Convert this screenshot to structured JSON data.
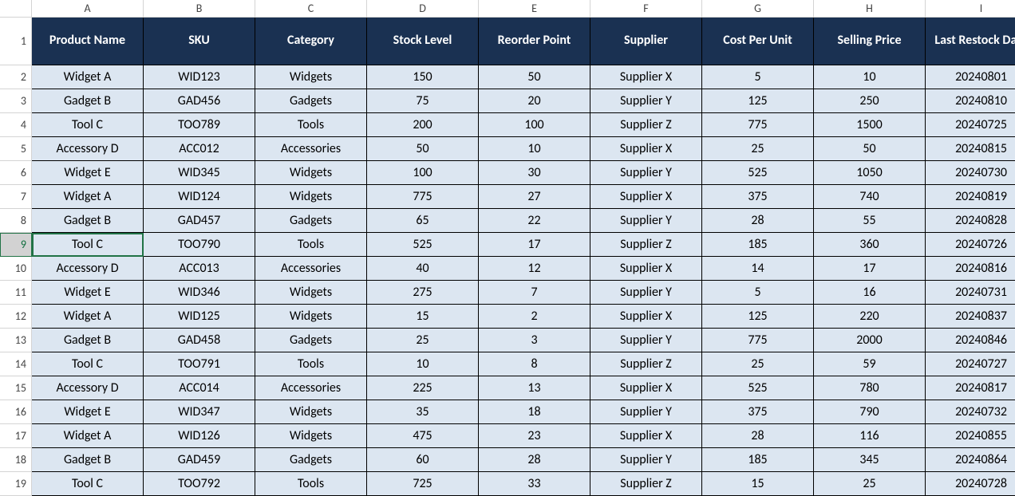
{
  "columns": [
    "A",
    "B",
    "C",
    "D",
    "E",
    "F",
    "G",
    "H",
    "I"
  ],
  "row_numbers": [
    1,
    2,
    3,
    4,
    5,
    6,
    7,
    8,
    9,
    10,
    11,
    12,
    13,
    14,
    15,
    16,
    17,
    18,
    19
  ],
  "selected_row": 9,
  "selected_cell": {
    "row": 9,
    "col": 0
  },
  "headers": [
    "Product Name",
    "SKU",
    "Category",
    "Stock Level",
    "Reorder Point",
    "Supplier",
    "Cost Per Unit",
    "Selling Price",
    "Last Restock Date"
  ],
  "rows": [
    [
      "Widget A",
      "WID123",
      "Widgets",
      "150",
      "50",
      "Supplier X",
      "5",
      "10",
      "20240801"
    ],
    [
      "Gadget B",
      "GAD456",
      "Gadgets",
      "75",
      "20",
      "Supplier Y",
      "125",
      "250",
      "20240810"
    ],
    [
      "Tool C",
      "TOO789",
      "Tools",
      "200",
      "100",
      "Supplier Z",
      "775",
      "1500",
      "20240725"
    ],
    [
      "Accessory D",
      "ACC012",
      "Accessories",
      "50",
      "10",
      "Supplier X",
      "25",
      "50",
      "20240815"
    ],
    [
      "Widget E",
      "WID345",
      "Widgets",
      "100",
      "30",
      "Supplier Y",
      "525",
      "1050",
      "20240730"
    ],
    [
      "Widget A",
      "WID124",
      "Widgets",
      "775",
      "27",
      "Supplier X",
      "375",
      "740",
      "20240819"
    ],
    [
      "Gadget B",
      "GAD457",
      "Gadgets",
      "65",
      "22",
      "Supplier Y",
      "28",
      "55",
      "20240828"
    ],
    [
      "Tool C",
      "TOO790",
      "Tools",
      "525",
      "17",
      "Supplier Z",
      "185",
      "360",
      "20240726"
    ],
    [
      "Accessory D",
      "ACC013",
      "Accessories",
      "40",
      "12",
      "Supplier X",
      "14",
      "17",
      "20240816"
    ],
    [
      "Widget E",
      "WID346",
      "Widgets",
      "275",
      "7",
      "Supplier Y",
      "5",
      "16",
      "20240731"
    ],
    [
      "Widget A",
      "WID125",
      "Widgets",
      "15",
      "2",
      "Supplier X",
      "125",
      "220",
      "20240837"
    ],
    [
      "Gadget B",
      "GAD458",
      "Gadgets",
      "25",
      "3",
      "Supplier Y",
      "775",
      "2000",
      "20240846"
    ],
    [
      "Tool C",
      "TOO791",
      "Tools",
      "10",
      "8",
      "Supplier Z",
      "25",
      "59",
      "20240727"
    ],
    [
      "Accessory D",
      "ACC014",
      "Accessories",
      "225",
      "13",
      "Supplier X",
      "525",
      "780",
      "20240817"
    ],
    [
      "Widget E",
      "WID347",
      "Widgets",
      "35",
      "18",
      "Supplier Y",
      "375",
      "790",
      "20240732"
    ],
    [
      "Widget A",
      "WID126",
      "Widgets",
      "475",
      "23",
      "Supplier X",
      "28",
      "116",
      "20240855"
    ],
    [
      "Gadget B",
      "GAD459",
      "Gadgets",
      "60",
      "28",
      "Supplier Y",
      "185",
      "345",
      "20240864"
    ],
    [
      "Tool C",
      "TOO792",
      "Tools",
      "725",
      "33",
      "Supplier Z",
      "15",
      "25",
      "20240728"
    ]
  ]
}
